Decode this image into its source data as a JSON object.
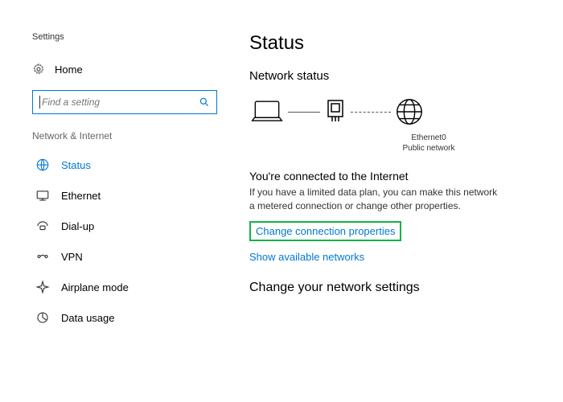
{
  "page_label": "Settings",
  "home_label": "Home",
  "search_placeholder": "Find a setting",
  "section_label": "Network & Internet",
  "nav": [
    {
      "label": "Status"
    },
    {
      "label": "Ethernet"
    },
    {
      "label": "Dial-up"
    },
    {
      "label": "VPN"
    },
    {
      "label": "Airplane mode"
    },
    {
      "label": "Data usage"
    }
  ],
  "main": {
    "title": "Status",
    "subtitle": "Network status",
    "adapter_name": "Ethernet0",
    "adapter_type": "Public network",
    "connected_title": "You're connected to the Internet",
    "connected_desc": "If you have a limited data plan, you can make this network a metered connection or change other properties.",
    "change_props": "Change connection properties",
    "show_networks": "Show available networks",
    "change_settings": "Change your network settings"
  }
}
